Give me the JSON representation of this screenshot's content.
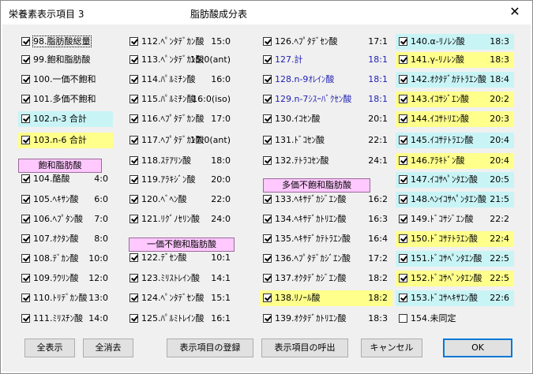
{
  "window": {
    "title": "栄養素表示項目 3",
    "subtitle": "脂肪酸成分表",
    "close_glyph": "✕"
  },
  "headers": {
    "saturated": "飽和脂肪酸",
    "monounsaturated": "一価不飽和脂肪酸",
    "polyunsaturated": "多価不飽和脂肪酸"
  },
  "column1": [
    {
      "label": "98.脂肪酸総量",
      "value": "",
      "checked": true,
      "bg": "",
      "focus": true
    },
    {
      "label": "99.飽和脂肪酸",
      "value": "",
      "checked": true,
      "bg": ""
    },
    {
      "label": "100.一価不飽和",
      "value": "",
      "checked": true,
      "bg": ""
    },
    {
      "label": "101.多価不飽和",
      "value": "",
      "checked": true,
      "bg": ""
    },
    {
      "label": "102.n-3 合計",
      "value": "",
      "checked": true,
      "bg": "cyan"
    },
    {
      "label": "103.n-6 合計",
      "value": "",
      "checked": true,
      "bg": "yellow"
    },
    {
      "label": "104.酪酸",
      "value": "4:0",
      "checked": true,
      "bg": ""
    },
    {
      "label": "105.ﾍｷｻﾝ酸",
      "value": "6:0",
      "checked": true,
      "bg": ""
    },
    {
      "label": "106.ﾍﾌﾟﾀﾝ酸",
      "value": "7:0",
      "checked": true,
      "bg": ""
    },
    {
      "label": "107.ｵｸﾀﾝ酸",
      "value": "8:0",
      "checked": true,
      "bg": ""
    },
    {
      "label": "108.ﾃﾞｶﾝ酸",
      "value": "10:0",
      "checked": true,
      "bg": ""
    },
    {
      "label": "109.ﾗｳﾘﾝ酸",
      "value": "12:0",
      "checked": true,
      "bg": ""
    },
    {
      "label": "110.ﾄﾘﾃﾞｶﾝ酸",
      "value": "13:0",
      "checked": true,
      "bg": ""
    },
    {
      "label": "111.ﾐﾘｽﾁﾝ酸",
      "value": "14:0",
      "checked": true,
      "bg": ""
    }
  ],
  "column2": [
    {
      "label": "112.ﾍﾟﾝﾀﾃﾞｶﾝ酸",
      "value": "15:0",
      "checked": true
    },
    {
      "label": "113.ﾍﾟﾝﾀﾃﾞｶﾝ酸",
      "value": "15:0(ant)",
      "checked": true
    },
    {
      "label": "114.ﾊﾟﾙﾐﾁﾝ酸",
      "value": "16:0",
      "checked": true
    },
    {
      "label": "115.ﾊﾟﾙﾐﾁﾝ酸",
      "value": "16:0(iso)",
      "checked": true
    },
    {
      "label": "116.ﾍﾌﾟﾀﾃﾞｶﾝ酸",
      "value": "17:0",
      "checked": true
    },
    {
      "label": "117.ﾍﾌﾟﾀﾃﾞｶﾝ酸",
      "value": "17:0(ant)",
      "checked": true
    },
    {
      "label": "118.ｽﾃｱﾘﾝ酸",
      "value": "18:0",
      "checked": true
    },
    {
      "label": "119.ｱﾗｷｼﾞﾝ酸",
      "value": "20:0",
      "checked": true
    },
    {
      "label": "120.ﾍﾞﾍﾝ酸",
      "value": "22:0",
      "checked": true
    },
    {
      "label": "121.ﾘｸﾞﾉｾﾘﾝ酸",
      "value": "24:0",
      "checked": true
    },
    {
      "label": "122.ﾃﾞｾﾝ酸",
      "value": "10:1",
      "checked": true
    },
    {
      "label": "123.ﾐﾘｽﾄﾚｲﾝ酸",
      "value": "14:1",
      "checked": true
    },
    {
      "label": "124.ﾍﾟﾝﾀﾃﾞｾﾝ酸",
      "value": "15:1",
      "checked": true
    },
    {
      "label": "125.ﾊﾟﾙﾐﾄﾚｲﾝ酸",
      "value": "16:1",
      "checked": true
    }
  ],
  "column3": [
    {
      "label": "126.ﾍﾌﾟﾀﾃﾞｾﾝ酸",
      "value": "17:1",
      "checked": true,
      "bg": "",
      "blue": false
    },
    {
      "label": "127.計",
      "value": "18:1",
      "checked": true,
      "bg": "",
      "blue": true
    },
    {
      "label": "128.n-9ｵﾚｲﾝ酸",
      "value": "18:1",
      "checked": true,
      "bg": "",
      "blue": true
    },
    {
      "label": "129.n-7ｼｽｰﾊﾞｸｾﾝ酸",
      "value": "18:1",
      "checked": true,
      "bg": "",
      "blue": true
    },
    {
      "label": "130.ｲｺｾﾝ酸",
      "value": "20:1",
      "checked": true,
      "bg": "",
      "blue": false
    },
    {
      "label": "131.ﾄﾞｺｾﾝ酸",
      "value": "22:1",
      "checked": true,
      "bg": "",
      "blue": false
    },
    {
      "label": "132.ﾃﾄﾗｺｾﾝ酸",
      "value": "24:1",
      "checked": true,
      "bg": "",
      "blue": false
    },
    {
      "label": "133.ﾍｷｻﾃﾞｶｼﾞｴﾝ酸",
      "value": "16:2",
      "checked": true,
      "bg": "",
      "blue": false
    },
    {
      "label": "134.ﾍｷｻﾃﾞｶﾄﾘｴﾝ酸",
      "value": "16:3",
      "checked": true,
      "bg": "",
      "blue": false
    },
    {
      "label": "135.ﾍｷｻﾃﾞｶﾃﾄﾗｴﾝ酸",
      "value": "16:4",
      "checked": true,
      "bg": "",
      "blue": false
    },
    {
      "label": "136.ﾍﾌﾟﾀﾃﾞｶｼﾞｴﾝ酸",
      "value": "17:2",
      "checked": true,
      "bg": "",
      "blue": false
    },
    {
      "label": "137.ｵｸﾀﾃﾞｶｼﾞｴﾝ酸",
      "value": "18:2",
      "checked": true,
      "bg": "",
      "blue": false
    },
    {
      "label": "138.ﾘﾉｰﾙ酸",
      "value": "18:2",
      "checked": true,
      "bg": "yellow",
      "blue": false
    },
    {
      "label": "139.ｵｸﾀﾃﾞｶﾄﾘｴﾝ酸",
      "value": "18:3",
      "checked": true,
      "bg": "",
      "blue": false
    }
  ],
  "column4": [
    {
      "label": "140.α-ﾘﾉﾚﾝ酸",
      "value": "18:3",
      "checked": true,
      "bg": "cyan"
    },
    {
      "label": "141.γ-ﾘﾉﾚﾝ酸",
      "value": "18:3",
      "checked": true,
      "bg": "yellow"
    },
    {
      "label": "142.ｵｸﾀﾃﾞｶﾃﾄﾗｴﾝ酸",
      "value": "18:4",
      "checked": true,
      "bg": "cyan"
    },
    {
      "label": "143.ｲｺｻｼﾞｴﾝ酸",
      "value": "20:2",
      "checked": true,
      "bg": "yellow"
    },
    {
      "label": "144.ｲｺｻﾄﾘｴﾝ酸",
      "value": "20:3",
      "checked": true,
      "bg": "yellow"
    },
    {
      "label": "145.ｲｺｻﾃﾄﾗｴﾝ酸",
      "value": "20:4",
      "checked": true,
      "bg": "cyan"
    },
    {
      "label": "146.ｱﾗｷﾄﾞﾝ酸",
      "value": "20:4",
      "checked": true,
      "bg": "yellow"
    },
    {
      "label": "147.ｲｺｻﾍﾟﾝﾀｴﾝ酸",
      "value": "20:5",
      "checked": true,
      "bg": "cyan"
    },
    {
      "label": "148.ﾍﾝｲｺｻﾍﾟﾝﾀｴﾝ酸",
      "value": "21:5",
      "checked": true,
      "bg": "cyan"
    },
    {
      "label": "149.ﾄﾞｺｻｼﾞｴﾝ酸",
      "value": "22:2",
      "checked": true,
      "bg": ""
    },
    {
      "label": "150.ﾄﾞｺｻﾃﾄﾗｴﾝ酸",
      "value": "22:4",
      "checked": true,
      "bg": "yellow"
    },
    {
      "label": "151.ﾄﾞｺｻﾍﾟﾝﾀｴﾝ酸",
      "value": "22:5",
      "checked": true,
      "bg": "cyan"
    },
    {
      "label": "152.ﾄﾞｺｻﾍﾟﾝﾀｴﾝ酸",
      "value": "22:5",
      "checked": true,
      "bg": "yellow"
    },
    {
      "label": "153.ﾄﾞｺｻﾍｷｻｴﾝ酸",
      "value": "22:6",
      "checked": true,
      "bg": "cyan"
    },
    {
      "label": "154.未同定",
      "value": "",
      "checked": false,
      "bg": ""
    }
  ],
  "buttons": {
    "show_all": "全表示",
    "clear_all": "全消去",
    "register": "表示項目の登録",
    "recall": "表示項目の呼出",
    "cancel": "キャンセル",
    "ok": "OK"
  },
  "colors": {
    "cyan_highlight": "#c9f4f6",
    "yellow_highlight": "#ffff8c",
    "header_pink": "#ffc8ff",
    "blue_text": "#1f1fb4"
  }
}
